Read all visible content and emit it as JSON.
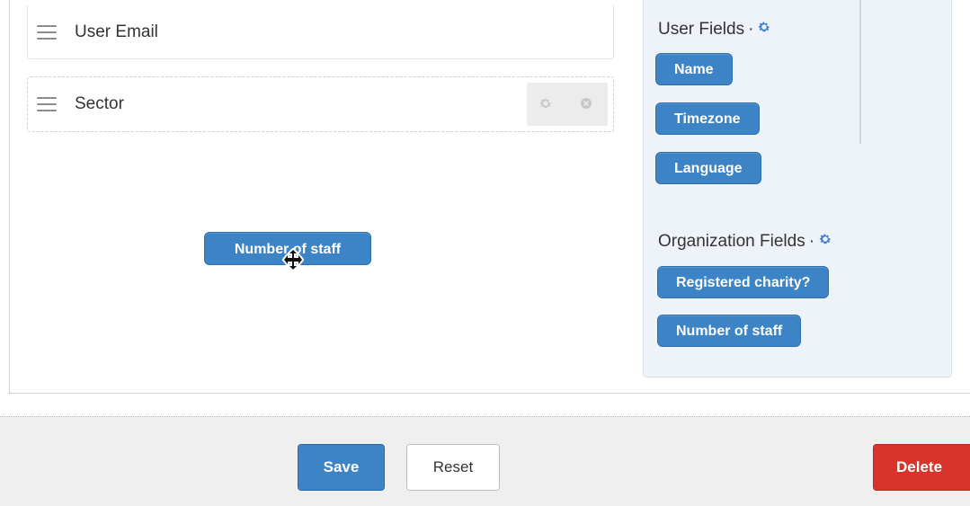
{
  "form_fields": [
    {
      "label": "User Email"
    },
    {
      "label": "Sector"
    }
  ],
  "sidebar": {
    "user_fields": {
      "title": "User Fields",
      "separator": "·",
      "tags": [
        "Name",
        "Timezone",
        "Language"
      ]
    },
    "organization_fields": {
      "title": "Organization Fields",
      "separator": "·",
      "tags": [
        "Registered charity?",
        "Number of staff"
      ]
    }
  },
  "dragging_item": {
    "label": "Number of staff"
  },
  "footer": {
    "save_label": "Save",
    "reset_label": "Reset",
    "delete_label": "Delete"
  },
  "colors": {
    "primary": "#3d84c7",
    "danger": "#d9342b",
    "sidebar_bg": "#eef3f9",
    "footer_bg": "#efefef"
  },
  "icons": {
    "drag_handle": "hamburger-icon",
    "settings": "gear-icon",
    "remove": "close-circle-icon",
    "move_cursor": "move-cursor-icon"
  }
}
